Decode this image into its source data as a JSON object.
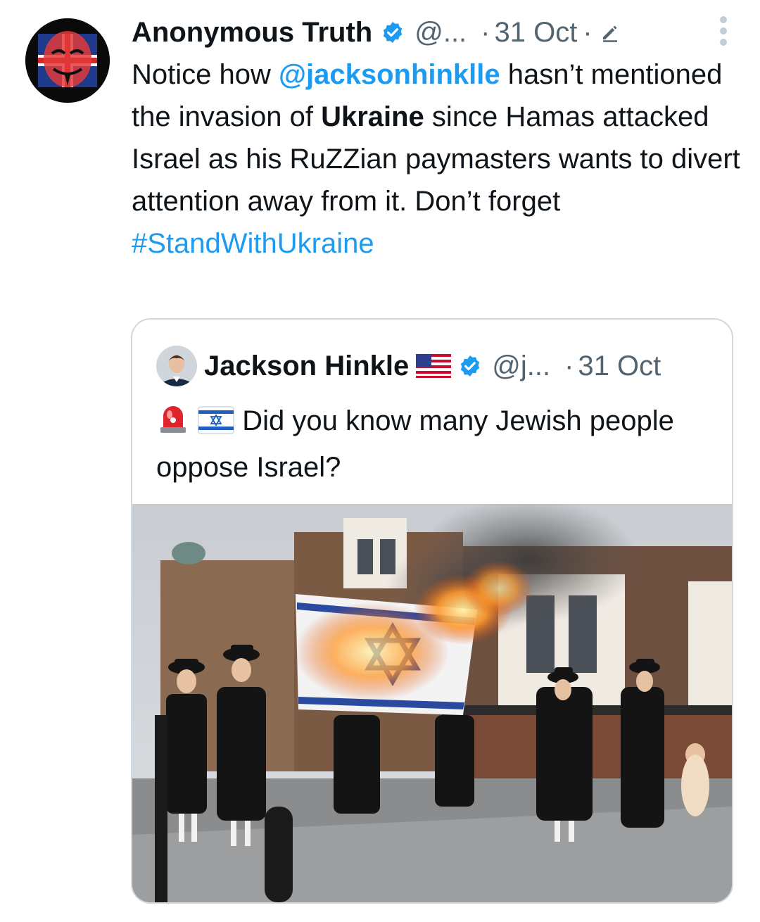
{
  "tweet": {
    "author_name": "Anonymous Truth",
    "handle": "@...",
    "separator": "·",
    "date": "31 Oct",
    "text_parts": {
      "p1": "Notice how ",
      "mention": "@jacksonhinklle",
      "p2": " hasn’t mentioned the invasion of ",
      "bold": "Ukraine",
      "p3": " since Hamas attacked Israel as his RuZZian paymasters wants to divert attention away from it.  Don’t forget ",
      "hashtag": "#StandWithUkraine"
    }
  },
  "quoted_tweet": {
    "author_name": "Jackson Hinkle",
    "handle": "@j...",
    "separator": "·",
    "date": "31 Oct",
    "text": "Did you know many Jewish people oppose Israel?"
  },
  "icons": {
    "verified": "verified-badge-icon",
    "edit": "edit-pencil-icon",
    "more": "more-vertical-icon",
    "flag": "us-flag-icon",
    "siren": "siren-emoji-icon",
    "israel_flag": "israel-flag-emoji-icon"
  },
  "colors": {
    "link": "#1d9bf0",
    "secondary_text": "#536471",
    "border": "#cfd9de",
    "primary_text": "#0f1419"
  }
}
